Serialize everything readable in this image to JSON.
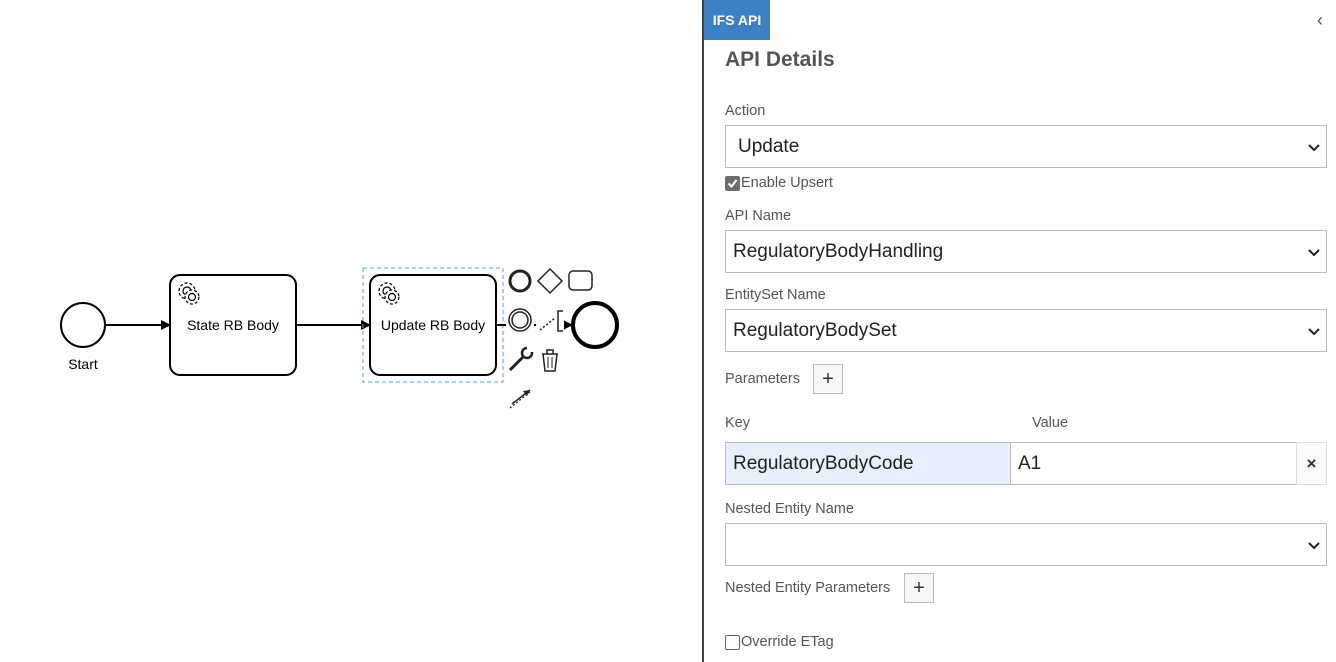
{
  "diagram": {
    "start_label": "Start",
    "task1_label": "State RB Body",
    "task2_label": "Update RB Body"
  },
  "panel": {
    "tab_label": "IFS API",
    "collapse_glyph": "‹",
    "heading": "API Details",
    "action": {
      "label": "Action",
      "value": "Update"
    },
    "enable_upsert": {
      "label": "Enable Upsert",
      "checked": true
    },
    "api_name": {
      "label": "API Name",
      "value": "RegulatoryBodyHandling"
    },
    "entityset_name": {
      "label": "EntitySet Name",
      "value": "RegulatoryBodySet"
    },
    "parameters": {
      "label": "Parameters",
      "add_glyph": "+",
      "key_header": "Key",
      "value_header": "Value",
      "rows": [
        {
          "key": "RegulatoryBodyCode",
          "value": "A1",
          "remove_glyph": "×"
        }
      ]
    },
    "nested_entity_name": {
      "label": "Nested Entity Name",
      "value": ""
    },
    "nested_entity_parameters": {
      "label": "Nested Entity Parameters",
      "add_glyph": "+"
    },
    "override_etag": {
      "label": "Override ETag",
      "checked": false
    }
  },
  "colors": {
    "tab_bg": "#3b81c4",
    "key_field_bg": "#e8f0fe",
    "selection_outline": "#5b9bd5"
  }
}
